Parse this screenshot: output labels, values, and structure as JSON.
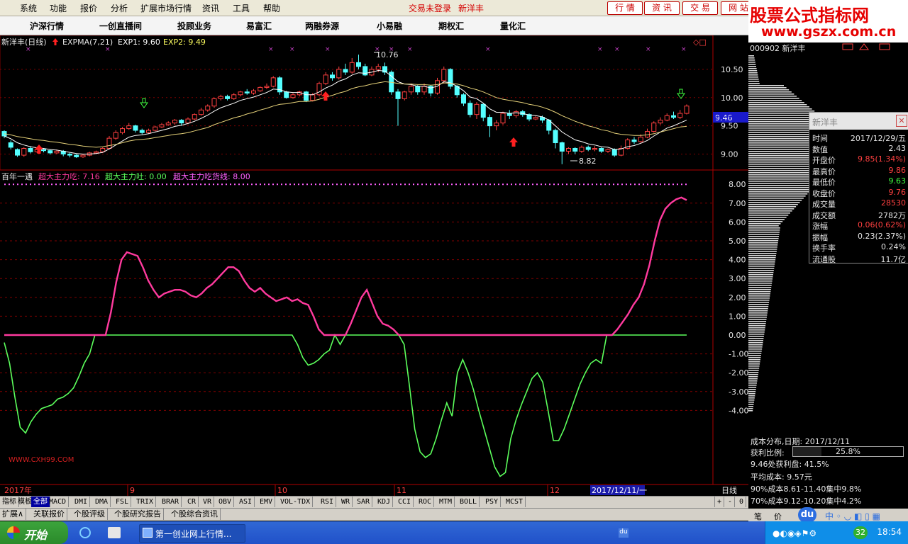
{
  "menu": {
    "items": [
      "系统",
      "功能",
      "报价",
      "分析",
      "扩展市场行情",
      "资讯",
      "工具",
      "帮助"
    ],
    "login_status": "交易未登录",
    "stock_name": "新洋丰",
    "right_tabs": [
      "行 情",
      "资 讯",
      "交 易",
      "网 站"
    ]
  },
  "toolbar": {
    "items": [
      "沪深行情",
      "一创直播间",
      "投顾业务",
      "易富汇",
      "两融券源",
      "小易融",
      "期权汇",
      "量化汇"
    ]
  },
  "logo": {
    "line1": "股票公式指标网",
    "line2": "www.gszx.com.cn"
  },
  "upper_panel": {
    "title": "新洋丰(日线)",
    "indicator": "EXPMA(7,21)",
    "exp1_label": "EXP1: 9.60",
    "exp2_label": "EXP2: 9.49",
    "high_annotation": "10.76",
    "low_annotation": "8.82",
    "price_ticks": [
      "10.50",
      "10.00",
      "9.50",
      "9.00"
    ],
    "current_price_tag": "9.46"
  },
  "lower_panel": {
    "title": "百年一遇",
    "series_a_label": "超大主力吃: 7.16",
    "series_b_label": "超大主力吐: 0.00",
    "series_c_label": "超大主力吃货线: 8.00",
    "ticks": [
      "8.00",
      "7.00",
      "6.00",
      "5.00",
      "4.00",
      "3.00",
      "2.00",
      "1.00",
      "0.00",
      "-1.00",
      "-2.00",
      "-3.00",
      "-4.00"
    ],
    "watermark": "WWW.CXH99.COM"
  },
  "date_axis": {
    "labels": [
      "2017年",
      "9",
      "10",
      "11",
      "12"
    ],
    "selected": "2017/12/11/一",
    "period": "日线"
  },
  "indicator_tabs": [
    "指标",
    "模板",
    "全部",
    "MACD",
    "DMI",
    "DMA",
    "FSL",
    "TRIX",
    "BRAR",
    "CR",
    "VR",
    "OBV",
    "ASI",
    "EMV",
    "VOL-TDX",
    "RSI",
    "WR",
    "SAR",
    "KDJ",
    "CCI",
    "ROC",
    "MTM",
    "BOLL",
    "PSY",
    "MCST"
  ],
  "zoom_controls": [
    "+",
    "-",
    "0"
  ],
  "function_tabs": [
    "扩展∧",
    "关联报价",
    "个股评级",
    "个股研究报告",
    "个股综合资讯"
  ],
  "info_window": {
    "title": "新洋丰",
    "rows": [
      {
        "k": "时间",
        "v": "2017/12/29/五"
      },
      {
        "k": "数值",
        "v": "2.43"
      },
      {
        "k": "开盘价",
        "v": "9.85(1.34%)"
      },
      {
        "k": "最高价",
        "v": "9.86"
      },
      {
        "k": "最低价",
        "v": "9.63"
      },
      {
        "k": "收盘价",
        "v": "9.76"
      },
      {
        "k": "成交量",
        "v": "28530"
      },
      {
        "k": "成交额",
        "v": "2782万"
      },
      {
        "k": "涨幅",
        "v": "0.06(0.62%)"
      },
      {
        "k": "振幅",
        "v": "0.23(2.37%)"
      },
      {
        "k": "换手率",
        "v": "0.24%"
      },
      {
        "k": "流通股",
        "v": "11.7亿"
      }
    ]
  },
  "cost_panel": {
    "header_code": "000902 新洋丰",
    "date_line": "成本分布,日期: 2017/12/11",
    "profit_ratio_label": "获利比例:",
    "profit_ratio_value": "25.8%",
    "profit_at_price": "9.46处获利盘: 41.5%",
    "avg_cost": "平均成本: 9.57元",
    "cost_90": "90%成本8.61-11.40集中9.8%",
    "cost_70": "70%成本9.12-10.20集中4.2%",
    "bottom_tabs": [
      "笔",
      "价"
    ]
  },
  "taskbar": {
    "start": "开始",
    "task": "第一创业网上行情...",
    "tray_badge": "32",
    "clock": "18:54"
  },
  "chart_data": {
    "type": "candlestick",
    "price_axis": {
      "ylim": [
        8.78,
        10.85
      ],
      "ticks": [
        10.5,
        10.0,
        9.5,
        9.0
      ]
    },
    "candles": [
      [
        9.4,
        9.32,
        9.42,
        9.28
      ],
      [
        9.2,
        9.12,
        9.24,
        9.08
      ],
      [
        9.08,
        8.98,
        9.1,
        8.95
      ],
      [
        8.98,
        9.1,
        9.12,
        8.95
      ],
      [
        9.1,
        9.04,
        9.14,
        9.01
      ],
      [
        9.04,
        9.08,
        9.1,
        9.02
      ],
      [
        9.08,
        9.06,
        9.1,
        9.03
      ],
      [
        9.06,
        9.02,
        9.08,
        8.99
      ],
      [
        9.02,
        9.05,
        9.08,
        9.0
      ],
      [
        9.05,
        9.0,
        9.07,
        8.96
      ],
      [
        9.0,
        8.98,
        9.02,
        8.94
      ],
      [
        8.98,
        8.95,
        9.0,
        8.93
      ],
      [
        8.95,
        8.98,
        9.0,
        8.93
      ],
      [
        8.98,
        9.02,
        9.04,
        8.96
      ],
      [
        9.02,
        9.04,
        9.06,
        9.0
      ],
      [
        9.04,
        9.1,
        9.12,
        9.02
      ],
      [
        9.1,
        9.28,
        9.32,
        9.08
      ],
      [
        9.28,
        9.38,
        9.42,
        9.25
      ],
      [
        9.38,
        9.45,
        9.48,
        9.35
      ],
      [
        9.45,
        9.5,
        9.55,
        9.43
      ],
      [
        9.5,
        9.42,
        9.52,
        9.38
      ],
      [
        9.42,
        9.38,
        9.45,
        9.35
      ],
      [
        9.38,
        9.42,
        9.45,
        9.36
      ],
      [
        9.42,
        9.48,
        9.5,
        9.4
      ],
      [
        9.48,
        9.52,
        9.55,
        9.46
      ],
      [
        9.52,
        9.55,
        9.58,
        9.5
      ],
      [
        9.55,
        9.6,
        9.62,
        9.52
      ],
      [
        9.6,
        9.55,
        9.62,
        9.5
      ],
      [
        9.55,
        9.62,
        9.65,
        9.53
      ],
      [
        9.62,
        9.7,
        9.72,
        9.6
      ],
      [
        9.7,
        9.78,
        9.82,
        9.68
      ],
      [
        9.78,
        9.85,
        9.88,
        9.75
      ],
      [
        9.85,
        9.98,
        10.0,
        9.82
      ],
      [
        9.98,
        10.02,
        10.05,
        9.95
      ],
      [
        10.02,
        9.98,
        10.05,
        9.95
      ],
      [
        9.98,
        10.05,
        10.08,
        9.96
      ],
      [
        10.05,
        10.1,
        10.12,
        10.02
      ],
      [
        10.1,
        10.08,
        10.15,
        10.05
      ],
      [
        10.08,
        10.12,
        10.15,
        10.05
      ],
      [
        10.12,
        10.18,
        10.2,
        10.1
      ],
      [
        10.18,
        10.2,
        10.25,
        10.15
      ],
      [
        10.2,
        10.35,
        10.38,
        10.18
      ],
      [
        10.35,
        10.1,
        10.38,
        10.05
      ],
      [
        10.1,
        10.0,
        10.12,
        9.98
      ],
      [
        10.0,
        10.05,
        10.08,
        9.98
      ],
      [
        10.05,
        10.1,
        10.12,
        10.02
      ],
      [
        10.1,
        9.95,
        10.12,
        9.92
      ],
      [
        9.95,
        10.05,
        10.08,
        9.93
      ],
      [
        10.05,
        10.25,
        10.28,
        10.02
      ],
      [
        10.25,
        10.4,
        10.45,
        10.22
      ],
      [
        10.4,
        10.35,
        10.45,
        10.3
      ],
      [
        10.35,
        10.5,
        10.55,
        10.32
      ],
      [
        10.5,
        10.45,
        10.6,
        10.4
      ],
      [
        10.45,
        10.62,
        10.7,
        10.42
      ],
      [
        10.62,
        10.55,
        10.76,
        10.5
      ],
      [
        10.55,
        10.4,
        10.6,
        10.38
      ],
      [
        10.4,
        10.5,
        10.55,
        10.38
      ],
      [
        10.5,
        10.55,
        10.6,
        10.45
      ],
      [
        10.55,
        10.45,
        10.62,
        10.4
      ],
      [
        10.45,
        10.1,
        10.48,
        10.05
      ],
      [
        10.1,
        9.98,
        10.15,
        9.5
      ],
      [
        9.98,
        10.1,
        10.12,
        9.95
      ],
      [
        10.1,
        10.2,
        10.25,
        10.05
      ],
      [
        10.2,
        10.1,
        10.22,
        10.05
      ],
      [
        10.1,
        10.2,
        10.25,
        10.05
      ],
      [
        10.2,
        10.08,
        10.22,
        10.02
      ],
      [
        10.08,
        10.3,
        10.35,
        10.05
      ],
      [
        10.3,
        10.5,
        10.55,
        10.25
      ],
      [
        10.5,
        10.2,
        10.52,
        10.15
      ],
      [
        10.2,
        10.05,
        10.22,
        10.0
      ],
      [
        10.05,
        9.9,
        10.08,
        9.85
      ],
      [
        9.9,
        9.7,
        9.95,
        9.65
      ],
      [
        9.7,
        9.88,
        9.92,
        9.62
      ],
      [
        9.88,
        9.65,
        9.9,
        9.58
      ],
      [
        9.65,
        9.5,
        9.7,
        9.3
      ],
      [
        9.5,
        9.55,
        9.6,
        9.42
      ],
      [
        9.55,
        9.72,
        9.75,
        9.52
      ],
      [
        9.72,
        9.68,
        9.78,
        9.62
      ],
      [
        9.68,
        9.75,
        9.78,
        9.64
      ],
      [
        9.75,
        9.7,
        9.78,
        9.66
      ],
      [
        9.7,
        9.62,
        9.72,
        9.58
      ],
      [
        9.62,
        9.65,
        9.68,
        9.6
      ],
      [
        9.65,
        9.6,
        9.68,
        9.55
      ],
      [
        9.6,
        9.42,
        9.62,
        9.35
      ],
      [
        9.42,
        9.2,
        9.45,
        9.1
      ],
      [
        9.2,
        9.05,
        9.22,
        8.82
      ],
      [
        9.05,
        9.1,
        9.12,
        9.0
      ],
      [
        9.1,
        9.05,
        9.12,
        9.0
      ],
      [
        9.05,
        9.12,
        9.15,
        9.02
      ],
      [
        9.12,
        9.08,
        9.15,
        9.05
      ],
      [
        9.08,
        9.1,
        9.14,
        9.05
      ],
      [
        9.1,
        9.05,
        9.12,
        9.02
      ],
      [
        9.05,
        9.08,
        9.1,
        9.02
      ],
      [
        9.08,
        8.98,
        9.1,
        8.95
      ],
      [
        8.98,
        9.1,
        9.15,
        8.96
      ],
      [
        9.1,
        9.25,
        9.28,
        9.08
      ],
      [
        9.25,
        9.22,
        9.3,
        9.18
      ],
      [
        9.22,
        9.3,
        9.35,
        9.2
      ],
      [
        9.3,
        9.4,
        9.45,
        9.28
      ],
      [
        9.4,
        9.55,
        9.58,
        9.38
      ],
      [
        9.55,
        9.6,
        9.65,
        9.52
      ],
      [
        9.6,
        9.68,
        9.72,
        9.58
      ],
      [
        9.68,
        9.65,
        9.75,
        9.62
      ],
      [
        9.65,
        9.72,
        9.78,
        9.62
      ],
      [
        9.72,
        9.85,
        9.88,
        9.7
      ]
    ],
    "exp1": [
      9.32,
      9.27,
      9.2,
      9.16,
      9.13,
      9.11,
      9.1,
      9.08,
      9.07,
      9.05,
      9.03,
      9.01,
      9.0,
      9.0,
      9.01,
      9.03,
      9.09,
      9.16,
      9.23,
      9.3,
      9.33,
      9.34,
      9.36,
      9.39,
      9.42,
      9.45,
      9.49,
      9.51,
      9.54,
      9.58,
      9.63,
      9.69,
      9.76,
      9.82,
      9.86,
      9.9,
      9.95,
      9.98,
      10.01,
      10.05,
      10.09,
      10.15,
      10.14,
      10.1,
      10.09,
      10.09,
      10.05,
      10.05,
      10.1,
      10.17,
      10.22,
      10.29,
      10.33,
      10.4,
      10.44,
      10.43,
      10.45,
      10.48,
      10.47,
      10.38,
      10.28,
      10.24,
      10.23,
      10.2,
      10.2,
      10.17,
      10.2,
      10.28,
      10.26,
      10.2,
      10.12,
      10.01,
      9.98,
      9.9,
      9.8,
      9.74,
      9.74,
      9.72,
      9.73,
      9.72,
      9.69,
      9.68,
      9.66,
      9.6,
      9.5,
      9.39,
      9.32,
      9.25,
      9.22,
      9.18,
      9.16,
      9.13,
      9.12,
      9.08,
      9.09,
      9.13,
      9.15,
      9.19,
      9.24,
      9.32,
      9.39,
      9.46,
      9.5,
      9.55,
      9.6
    ],
    "exp2": [
      9.36,
      9.34,
      9.31,
      9.29,
      9.27,
      9.25,
      9.24,
      9.22,
      9.21,
      9.19,
      9.17,
      9.16,
      9.14,
      9.13,
      9.12,
      9.13,
      9.15,
      9.17,
      9.2,
      9.23,
      9.25,
      9.26,
      9.27,
      9.29,
      9.31,
      9.33,
      9.35,
      9.36,
      9.38,
      9.41,
      9.44,
      9.47,
      9.52,
      9.56,
      9.6,
      9.64,
      9.67,
      9.71,
      9.74,
      9.78,
      9.81,
      9.85,
      9.88,
      9.89,
      9.91,
      9.93,
      9.93,
      9.94,
      9.97,
      10.01,
      10.04,
      10.08,
      10.11,
      10.16,
      10.19,
      10.21,
      10.24,
      10.26,
      10.28,
      10.27,
      10.25,
      10.24,
      10.24,
      10.23,
      10.23,
      10.22,
      10.23,
      10.26,
      10.25,
      10.24,
      10.21,
      10.17,
      10.14,
      10.1,
      10.05,
      10.0,
      9.97,
      9.95,
      9.93,
      9.91,
      9.88,
      9.86,
      9.83,
      9.79,
      9.74,
      9.68,
      9.63,
      9.58,
      9.54,
      9.5,
      9.47,
      9.43,
      9.41,
      9.37,
      9.35,
      9.34,
      9.33,
      9.33,
      9.34,
      9.36,
      9.39,
      9.42,
      9.45,
      9.48,
      9.49
    ],
    "osc_axis": {
      "ylim": [
        -5.7,
        8.6
      ],
      "ticks": [
        8,
        7,
        6,
        5,
        4,
        3,
        2,
        1,
        0,
        -1,
        -2,
        -3,
        -4
      ]
    },
    "series_a": [
      0,
      0,
      0,
      0,
      0,
      0,
      0,
      0,
      0,
      0,
      0,
      0,
      0,
      0,
      0,
      0,
      0,
      0,
      0,
      0,
      1.2,
      2.8,
      4.0,
      4.4,
      4.3,
      4.2,
      3.6,
      2.9,
      2.4,
      2.0,
      2.2,
      2.3,
      2.4,
      2.4,
      2.3,
      2.1,
      2.0,
      2.2,
      2.5,
      2.7,
      3.0,
      3.3,
      3.6,
      3.6,
      3.4,
      2.9,
      2.5,
      2.3,
      2.5,
      2.2,
      2.0,
      1.8,
      1.9,
      2.0,
      1.8,
      1.9,
      1.7,
      1.6,
      1.0,
      0.3,
      0,
      0,
      0,
      0,
      0,
      0.6,
      1.3,
      2.0,
      2.4,
      1.7,
      1.0,
      0.6,
      0.5,
      0.3,
      0,
      0,
      0,
      0,
      0,
      0,
      0,
      0,
      0,
      0,
      0,
      0,
      0,
      0,
      0,
      0,
      0,
      0,
      0,
      0,
      0,
      0,
      0,
      0,
      0,
      0,
      0,
      0,
      0,
      0,
      0,
      0,
      0,
      0,
      0,
      0,
      0,
      0,
      0,
      0,
      0,
      0.3,
      0.7,
      1.1,
      1.6,
      2.0,
      2.7,
      3.7,
      5.0,
      6.1,
      6.7,
      7.0,
      7.2,
      7.3,
      7.16
    ],
    "series_b": [
      -0.4,
      -1.5,
      -3.3,
      -4.9,
      -5.2,
      -4.6,
      -4.2,
      -3.9,
      -3.8,
      -3.7,
      -3.4,
      -3.3,
      -3.1,
      -2.8,
      -2.2,
      -1.5,
      -1.0,
      0,
      0,
      0,
      0,
      0,
      0,
      0,
      0,
      0,
      0,
      0,
      0,
      0,
      0,
      0,
      0,
      0,
      0,
      0,
      0,
      0,
      0,
      0,
      0,
      0,
      0,
      0,
      0,
      0,
      0,
      0,
      0,
      0,
      0,
      0,
      0,
      0,
      0,
      -0.5,
      -1.2,
      -1.6,
      -1.5,
      -1.3,
      -1.0,
      -0.8,
      0,
      -0.5,
      0,
      0,
      0,
      0,
      0,
      0,
      0,
      0,
      0,
      0,
      0,
      -0.5,
      -2.7,
      -5.0,
      -6.2,
      -6.5,
      -6.3,
      -5.5,
      -4.5,
      -3.6,
      -4.3,
      -2.0,
      -1.3,
      -2.0,
      -2.9,
      -4.0,
      -5.0,
      -6.0,
      -7.0,
      -7.5,
      -7.3,
      -5.5,
      -4.5,
      -3.7,
      -3.0,
      -2.3,
      -2.0,
      -2.5,
      -4.0,
      -5.6,
      -5.6,
      -5.0,
      -4.2,
      -3.4,
      -2.6,
      -2.0,
      -1.5,
      -1.3,
      -1.5,
      0,
      0,
      0,
      0,
      0,
      0,
      0,
      0,
      0,
      0,
      0,
      0,
      0,
      0,
      0,
      0
    ]
  }
}
